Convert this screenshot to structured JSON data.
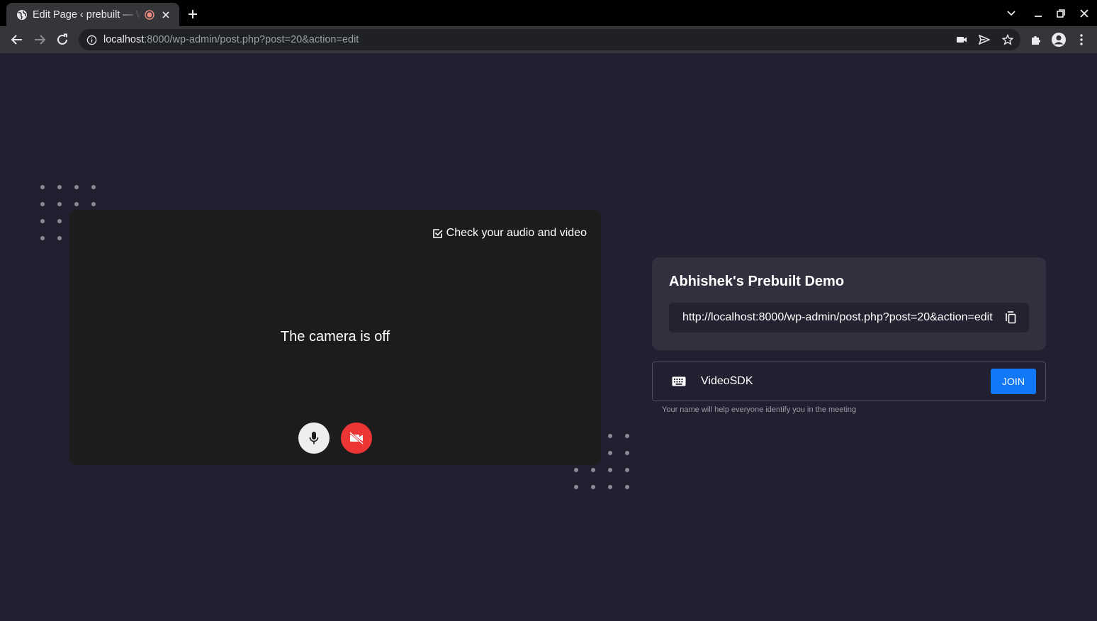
{
  "browser": {
    "tab": {
      "title": "Edit Page ‹ prebuilt — WordPress"
    },
    "url": {
      "host": "localhost",
      "rest": ":8000/wp-admin/post.php?post=20&action=edit"
    }
  },
  "preview": {
    "check_label": "Check your audio and video",
    "camera_status": "The camera is off"
  },
  "meeting": {
    "title": "Abhishek's Prebuilt Demo",
    "link": "http://localhost:8000/wp-admin/post.php?post=20&action=edit"
  },
  "join": {
    "name_value": "VideoSDK",
    "button_label": "JOIN",
    "helper": "Your name will help everyone identify you in the meeting"
  },
  "colors": {
    "page_bg": "#202031",
    "card_bg": "#31303f",
    "join_blue": "#1178f8",
    "cam_off_red": "#ee3535"
  }
}
